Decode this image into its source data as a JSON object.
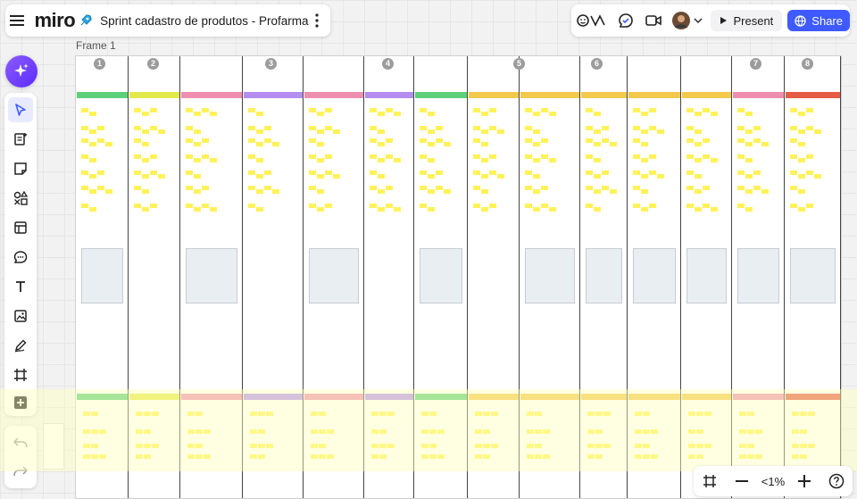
{
  "header": {
    "logo": "miro",
    "board_title": "Sprint cadastro de produtos - Profarma",
    "present_label": "Present",
    "share_label": "Share"
  },
  "canvas": {
    "frame_label": "Frame 1",
    "column_numbers": [
      "1",
      "2",
      "3",
      "4",
      "5",
      "6",
      "7",
      "8"
    ]
  },
  "zoom": {
    "level": "<1%"
  },
  "colors": {
    "accent": "#3f5bff",
    "sticky": "#fff25a",
    "header_green": "#5fd07a",
    "header_yellow": "#e3e94a",
    "header_pink": "#ef8fb0",
    "header_purple": "#b38ef0",
    "header_orange": "#f2c94c",
    "header_red": "#e65b46"
  }
}
